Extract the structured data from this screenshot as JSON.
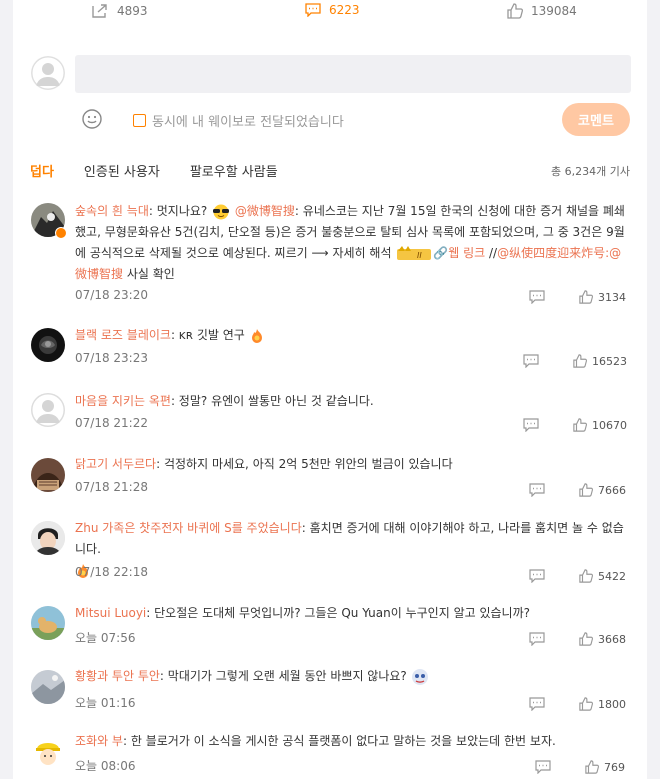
{
  "actions": {
    "forward_count": "4893",
    "comment_count": "6223",
    "like_count": "139084"
  },
  "composer": {
    "share_label": "동시에 내 웨이보로 전달되었습니다",
    "submit_label": "코멘트"
  },
  "tabs": [
    {
      "label": "덥다"
    },
    {
      "label": "인증된 사용자"
    },
    {
      "label": "팔로우할 사람들"
    }
  ],
  "total_label": "총 6,234개 기사",
  "comments": [
    {
      "user": "숲속의 흰 늑대",
      "text_a": ": 멋지나요? ",
      "mention": "@微博智搜",
      "text_b": ": 유네스코는 지난 7월 15일 한국의 신청에 대한 증거 채널을 폐쇄했고, 무형문화유산 5건(김치, 단오절 등)은 증거 불충분으로 탈퇴 심사 목록에 포함되었으며, 그 중 3건은 9월에 공식적으로 삭제될 것으로 예상된다. 찌르기 ⟶ 자세히 해석 ",
      "link1": "🔗웹 링크",
      "sep": " //",
      "link2": "@纵使四度迎来炸号:@微博智搜",
      "text_c": " 사실 확인",
      "time": "07/18 23:20",
      "likes": "3134"
    },
    {
      "user": "블랙 로즈 블레이크",
      "text_a": ": ᴋʀ 깃발 연구 ",
      "time": "07/18 23:23",
      "likes": "16523"
    },
    {
      "user": "마음을 지키는 옥편",
      "text_a": ": 정말? 유엔이 쌀통만 아닌 것 같습니다.",
      "time": "07/18 21:22",
      "likes": "10670"
    },
    {
      "user": "닭고기 서두르다",
      "text_a": ": 걱정하지 마세요, 아직 2억 5천만 위안의 벌금이 있습니다",
      "time": "07/18 21:28",
      "likes": "7666"
    },
    {
      "user": "Zhu 가족은 찻주전자 바퀴에 S를 주었습니다",
      "text_a": ": 훔치면 증거에 대해 이야기해야 하고, 나라를 훔치면 놀 수 없습니다.",
      "time": "07/18 22:18",
      "likes": "5422"
    },
    {
      "user": "Mitsui Luoyi",
      "text_a": ": 단오절은 도대체 무엇입니까? 그들은 Qu Yuan이 누구인지 알고 있습니까?",
      "time": "오늘 07:56",
      "likes": "3668"
    },
    {
      "user": "황황과 투안 투안",
      "text_a": ": 막대기가 그렇게 오랜 세월 동안 바쁘지 않나요? ",
      "time": "오늘 01:16",
      "likes": "1800"
    },
    {
      "user": "조화와 부",
      "text_a": ": 한 블로거가 이 소식을 게시한 공식 플랫폼이 없다고 말하는 것을 보았는데 한번 보자.",
      "time": "오늘 08:06",
      "likes": "769"
    }
  ]
}
